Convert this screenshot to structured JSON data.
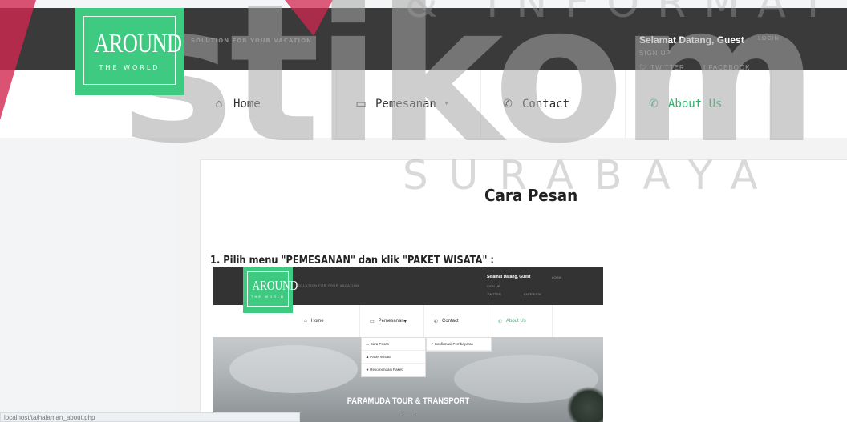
{
  "header": {
    "logo_main": "AROUND",
    "logo_sub": "THE WORLD",
    "tagline": "SOLUTION FOR YOUR VACATION",
    "welcome": "Selamat Datang, Guest",
    "login": "LOGIN",
    "signup": "SIGN UP",
    "twitter": "TWITTER",
    "facebook": "FACEBOOK"
  },
  "nav": {
    "items": [
      {
        "label": "Home",
        "icon": "home-icon"
      },
      {
        "label": "Pemesanan",
        "icon": "card-icon"
      },
      {
        "label": "Contact",
        "icon": "phone-icon"
      },
      {
        "label": "About Us",
        "icon": "phone-icon"
      }
    ]
  },
  "content": {
    "title": "Cara Pesan",
    "step1": "1. Pilih menu \"PEMESANAN\" dan klik \"PAKET WISATA\" :"
  },
  "screenshot": {
    "logo_main": "AROUND",
    "logo_sub": "THE WORLD",
    "tagline": "SOLUTION FOR YOUR VACATION",
    "welcome": "Selamat Datang, Guest",
    "login": "LOGIN",
    "signup": "SIGN UP",
    "twitter": "TWITTER",
    "facebook": "FACEBOOK",
    "nav": [
      "Home",
      "Pemesanan",
      "Contact",
      "About Us"
    ],
    "dropdown_left": [
      "Cara Pesan",
      "Paket Wisata",
      "Rekomendasi Paket"
    ],
    "dropdown_right": [
      "Konfirmasi Pembayaran"
    ],
    "hero_title": "PARAMUDA TOUR & TRANSPORT"
  },
  "status_bar": {
    "url": "localhost/ta/halaman_about.php"
  },
  "watermark": {
    "top_text": "& INFORMATIKA",
    "main_text": "stikom",
    "bottom_text": "SURABAYA"
  },
  "colors": {
    "accent_green": "#3fca81",
    "header_dark": "#3a3a3a",
    "watermark_red": "#d22850"
  }
}
